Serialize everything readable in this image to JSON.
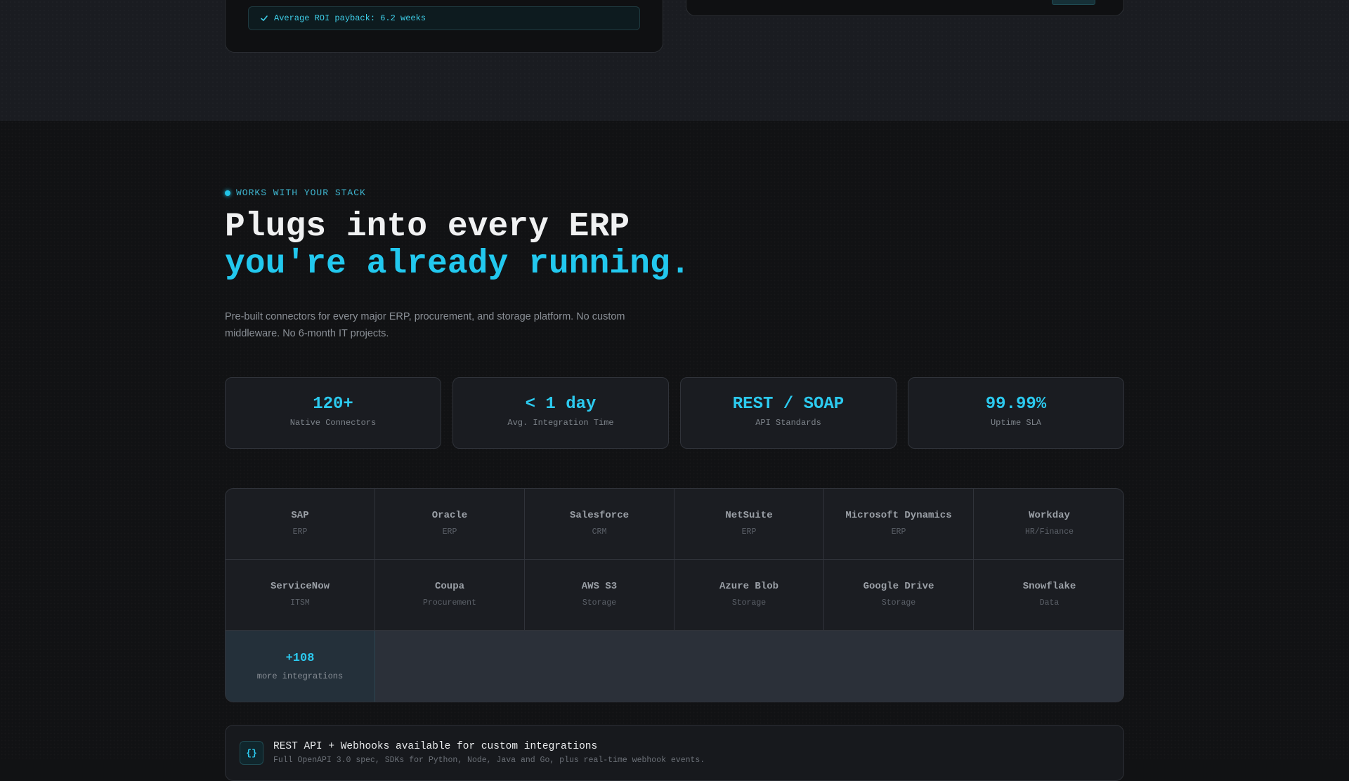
{
  "previous_section": {
    "roi_text": "Average ROI payback: 6.2 weeks"
  },
  "header": {
    "eyebrow": "WORKS WITH YOUR STACK",
    "headline_line1": "Plugs into every ERP",
    "headline_line2": "you're already running.",
    "subtext": "Pre-built connectors for every major ERP, procurement, and storage platform. No custom middleware. No 6-month IT projects."
  },
  "stats": [
    {
      "value": "120+",
      "label": "Native Connectors"
    },
    {
      "value": "< 1 day",
      "label": "Avg. Integration Time"
    },
    {
      "value": "REST / SOAP",
      "label": "API Standards"
    },
    {
      "value": "99.99%",
      "label": "Uptime SLA"
    }
  ],
  "integrations": [
    {
      "name": "SAP",
      "category": "ERP"
    },
    {
      "name": "Oracle",
      "category": "ERP"
    },
    {
      "name": "Salesforce",
      "category": "CRM"
    },
    {
      "name": "NetSuite",
      "category": "ERP"
    },
    {
      "name": "Microsoft Dynamics",
      "category": "ERP"
    },
    {
      "name": "Workday",
      "category": "HR/Finance"
    },
    {
      "name": "ServiceNow",
      "category": "ITSM"
    },
    {
      "name": "Coupa",
      "category": "Procurement"
    },
    {
      "name": "AWS S3",
      "category": "Storage"
    },
    {
      "name": "Azure Blob",
      "category": "Storage"
    },
    {
      "name": "Google Drive",
      "category": "Storage"
    },
    {
      "name": "Snowflake",
      "category": "Data"
    }
  ],
  "more": {
    "count": "+108",
    "label": "more integrations"
  },
  "api_banner": {
    "icon": "{}",
    "title": "REST API + Webhooks available for custom integrations",
    "description": "Full OpenAPI 3.0 spec, SDKs for Python, Node, Java and Go, plus real-time webhook events."
  },
  "colors": {
    "accent": "#22c8ee",
    "background": "#111214",
    "card": "#1a1c21"
  }
}
